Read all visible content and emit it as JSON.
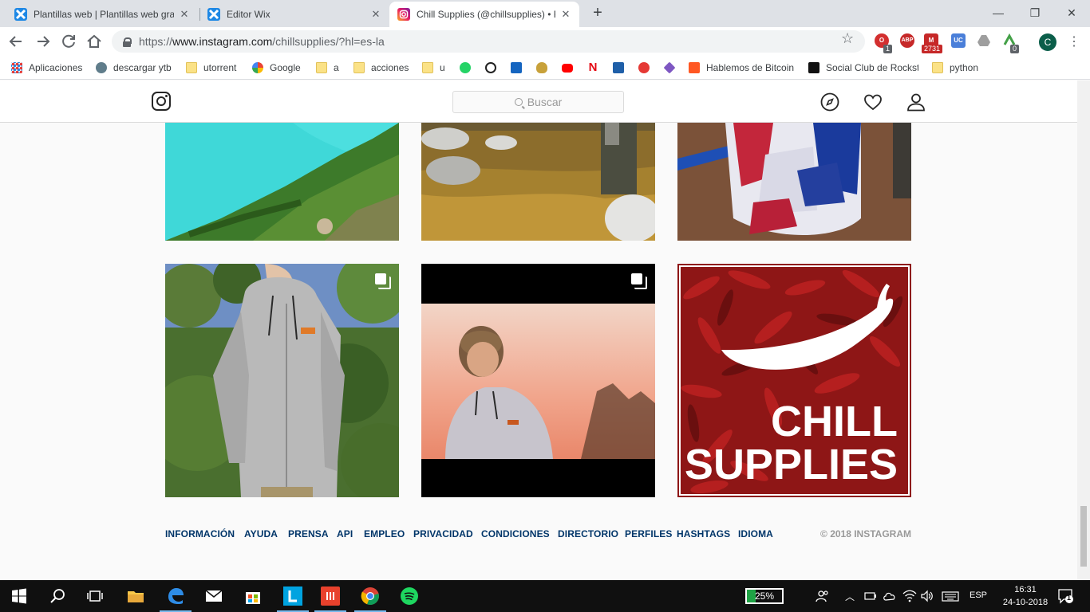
{
  "browser": {
    "tabs": [
      {
        "title": "Plantillas web | Plantillas web gra",
        "active": false
      },
      {
        "title": "Editor Wix",
        "active": false
      },
      {
        "title": "Chill Supplies (@chillsupplies) • F",
        "active": true
      }
    ],
    "url": {
      "protocol": "https://",
      "domain": "www.instagram.com",
      "path": "/chillsupplies/?hl=es-la"
    },
    "extensions": [
      {
        "name": "opera-vpn-icon",
        "badge": "1",
        "color": "#d32f2f",
        "label": "O"
      },
      {
        "name": "adblock-plus-icon",
        "badge": "",
        "color": "#c62828",
        "label": "ABP"
      },
      {
        "name": "gmail-checker-icon",
        "badge": "2731",
        "color": "#c62828",
        "label": "M"
      },
      {
        "name": "uc-extension-icon",
        "badge": "",
        "color": "#4a7fd9",
        "label": "UC"
      },
      {
        "name": "google-drive-icon",
        "badge": "",
        "color": "#9e9e9e",
        "label": ""
      },
      {
        "name": "green-extension-icon",
        "badge": "0",
        "color": "#43a047",
        "label": ""
      }
    ],
    "profile_initial": "C",
    "bookmarks": [
      {
        "label": "Aplicaciones",
        "icon": "apps-grid-icon",
        "type": "apps"
      },
      {
        "label": "descargar ytb",
        "icon": "sync-icon",
        "type": "site"
      },
      {
        "label": "utorrent",
        "icon": "folder-icon",
        "type": "folder"
      },
      {
        "label": "Google",
        "icon": "google-icon",
        "type": "site"
      },
      {
        "label": "a",
        "icon": "folder-icon",
        "type": "folder"
      },
      {
        "label": "acciones",
        "icon": "folder-icon",
        "type": "folder"
      },
      {
        "label": "u",
        "icon": "folder-icon",
        "type": "folder"
      },
      {
        "label": "",
        "icon": "whatsapp-icon",
        "type": "site"
      },
      {
        "label": "",
        "icon": "coinmarket-icon",
        "type": "site"
      },
      {
        "label": "",
        "icon": "edge-site-icon",
        "type": "site"
      },
      {
        "label": "",
        "icon": "shield-site-icon",
        "type": "site"
      },
      {
        "label": "",
        "icon": "youtube-icon",
        "type": "site"
      },
      {
        "label": "",
        "icon": "netflix-icon",
        "type": "site"
      },
      {
        "label": "",
        "icon": "calendar-site-icon",
        "type": "site"
      },
      {
        "label": "",
        "icon": "film-reel-icon",
        "type": "site"
      },
      {
        "label": "",
        "icon": "diamond-site-icon",
        "type": "site"
      },
      {
        "label": "Hablemos de Bitcoin",
        "icon": "blogger-icon",
        "type": "site"
      },
      {
        "label": "Social Club de Rockst",
        "icon": "rockstar-icon",
        "type": "site"
      },
      {
        "label": "python",
        "icon": "folder-icon",
        "type": "folder"
      }
    ]
  },
  "instagram": {
    "search_placeholder": "Buscar",
    "posts": [
      {
        "name": "post-turquoise-lake",
        "multi": false
      },
      {
        "name": "post-river-rocks",
        "multi": false
      },
      {
        "name": "post-motocross-rider",
        "multi": false
      },
      {
        "name": "post-grey-hoodie",
        "multi": true
      },
      {
        "name": "post-sunset-hoodie",
        "multi": true
      },
      {
        "name": "post-chill-supplies-logo",
        "multi": false
      }
    ],
    "logo_text": [
      "CHILL",
      "SUPPLIES"
    ],
    "footer_links": [
      "INFORMACIÓN",
      "AYUDA",
      "PRENSA",
      "API",
      "EMPLEO",
      "PRIVACIDAD",
      "CONDICIONES",
      "DIRECTORIO",
      "PERFILES",
      "HASHTAGS",
      "IDIOMA"
    ],
    "copyright": "© 2018 INSTAGRAM"
  },
  "taskbar": {
    "battery": "25%",
    "battery_level": 0.25,
    "language": "ESP",
    "time": "16:31",
    "date": "24-10-2018",
    "notifications": "1"
  }
}
